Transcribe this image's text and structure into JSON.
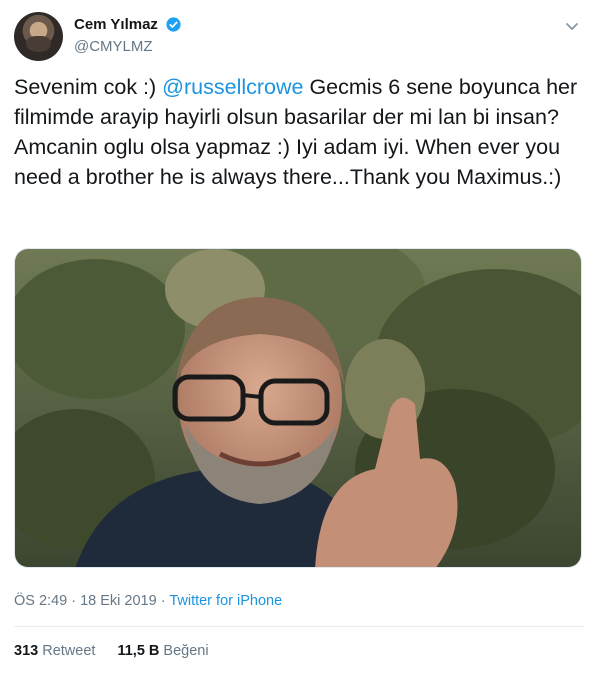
{
  "user": {
    "display_name": "Cem Yılmaz",
    "handle": "@CMYLMZ",
    "verified_icon": "verified-badge-icon"
  },
  "tweet": {
    "text_before": "Sevenim cok :) ",
    "mention": "@russellcrowe",
    "text_after": " Gecmis 6 sene boyunca her filmimde arayip hayirli olsun basarilar der mi lan bi insan? Amcanin oglu olsa yapmaz :) Iyi adam iyi.  When ever you need a brother he is always there...Thank you Maximus.:)"
  },
  "meta": {
    "time": "ÖS 2:49",
    "separator": " · ",
    "date": "18 Eki 2019",
    "source": "Twitter for iPhone"
  },
  "stats": {
    "retweets_count": "313",
    "retweets_label": "Retweet",
    "likes_count": "11,5 B",
    "likes_label": "Beğeni"
  },
  "colors": {
    "link": "#1b95e0",
    "muted": "#657786",
    "text": "#14171a"
  }
}
